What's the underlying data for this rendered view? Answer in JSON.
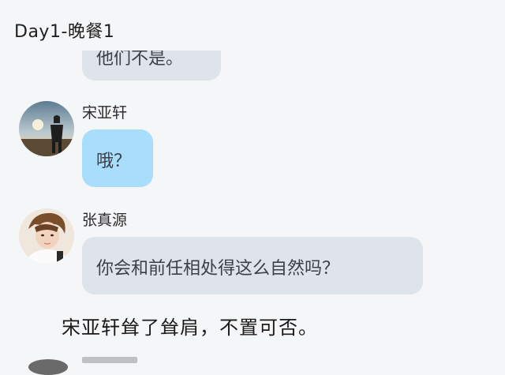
{
  "header": {
    "title": "Day1-晚餐1"
  },
  "chat": {
    "clipped_message": "他们不是。",
    "messages": [
      {
        "sender": "宋亚轩",
        "text": "哦？"
      },
      {
        "sender": "张真源",
        "text": "你会和前任相处得这么自然吗？"
      }
    ],
    "narration": "宋亚轩耸了耸肩，不置可否。"
  },
  "colors": {
    "background": "#f5f6f8",
    "bubble_gray": "#dfe3ea",
    "bubble_blue": "#a8ddfb"
  }
}
